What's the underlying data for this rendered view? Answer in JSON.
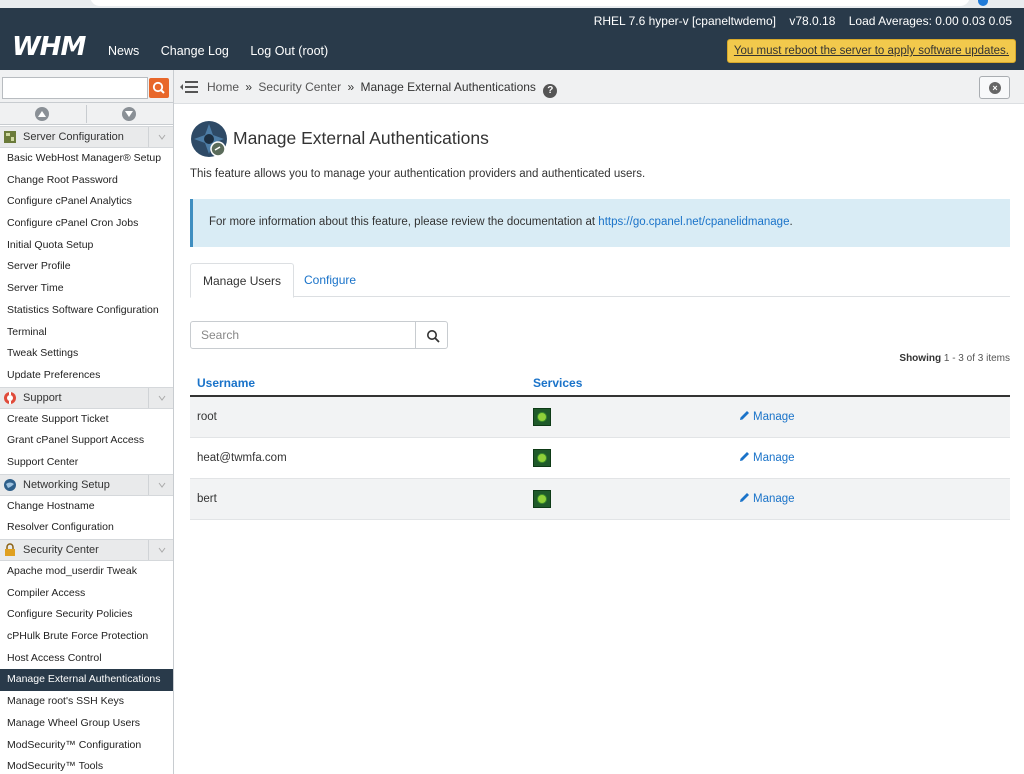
{
  "header": {
    "os": "RHEL 7.6 hyper-v [cpaneltwdemo]",
    "version": "v78.0.18",
    "load_averages": "Load Averages: 0.00 0.03 0.05",
    "logo": "WHM",
    "nav": [
      "News",
      "Change Log",
      "Log Out (root)"
    ],
    "reboot_notice": "You must reboot the server to apply software updates."
  },
  "breadcrumb": {
    "home": "Home",
    "section": "Security Center",
    "current": "Manage External Authentications",
    "sep": "»"
  },
  "sidebar": {
    "search_placeholder": "",
    "categories": [
      {
        "label": "Server Configuration",
        "icon": "server-config-icon",
        "items": [
          "Basic WebHost Manager® Setup",
          "Change Root Password",
          "Configure cPanel Analytics",
          "Configure cPanel Cron Jobs",
          "Initial Quota Setup",
          "Server Profile",
          "Server Time",
          "Statistics Software Configuration",
          "Terminal",
          "Tweak Settings",
          "Update Preferences"
        ]
      },
      {
        "label": "Support",
        "icon": "support-lifebuoy-icon",
        "items": [
          "Create Support Ticket",
          "Grant cPanel Support Access",
          "Support Center"
        ]
      },
      {
        "label": "Networking Setup",
        "icon": "networking-globe-icon",
        "items": [
          "Change Hostname",
          "Resolver Configuration"
        ]
      },
      {
        "label": "Security Center",
        "icon": "security-lock-icon",
        "items": [
          "Apache mod_userdir Tweak",
          "Compiler Access",
          "Configure Security Policies",
          "cPHulk Brute Force Protection",
          "Host Access Control",
          "Manage External Authentications",
          "Manage root's SSH Keys",
          "Manage Wheel Group Users",
          "ModSecurity™ Configuration",
          "ModSecurity™ Tools"
        ]
      }
    ],
    "active_item": "Manage External Authentications"
  },
  "main": {
    "title": "Manage External Authentications",
    "description": "This feature allows you to manage your authentication providers and authenticated users.",
    "info_text": "For more information about this feature, please review the documentation at ",
    "info_link": "https://go.cpanel.net/cpanelidmanage",
    "info_end": ".",
    "tabs": [
      "Manage Users",
      "Configure"
    ],
    "search_placeholder": "Search",
    "showing_label": "Showing",
    "showing_range": "1 - 3 of 3 items",
    "columns": [
      "Username",
      "Services",
      ""
    ],
    "rows": [
      {
        "username": "root",
        "action": "Manage"
      },
      {
        "username": "heat@twmfa.com",
        "action": "Manage"
      },
      {
        "username": "bert",
        "action": "Manage"
      }
    ]
  },
  "colors": {
    "header_bg": "#293a4a",
    "accent": "#1a73c9",
    "notice_bg": "#f2c94c",
    "info_bg": "#d9ecf5"
  }
}
